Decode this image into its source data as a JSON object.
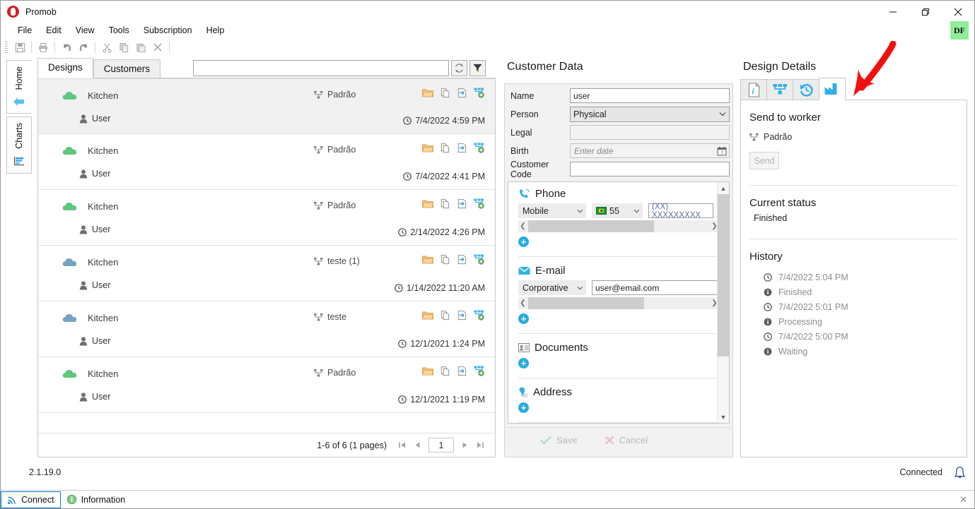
{
  "window": {
    "title": "Promob",
    "minimize": "—",
    "maximize": "❐",
    "close": "✕",
    "avatar_initials": "DF",
    "avatar_color": "#90ee9b"
  },
  "menubar": {
    "items": [
      "File",
      "Edit",
      "View",
      "Tools",
      "Subscription",
      "Help"
    ]
  },
  "toolbar": {
    "icons": [
      "save-icon",
      "print-icon",
      "undo-icon",
      "redo-icon",
      "cut-icon",
      "copy-icon",
      "paste-icon",
      "delete-icon"
    ]
  },
  "sidebar": {
    "items": [
      {
        "label": "Home",
        "icon": "home-icon",
        "active": false
      },
      {
        "label": "Charts",
        "icon": "chart-icon",
        "active": true
      }
    ]
  },
  "designs_panel": {
    "tabs": [
      {
        "label": "Designs",
        "active": true
      },
      {
        "label": "Customers",
        "active": false
      }
    ],
    "search": {
      "value": "",
      "placeholder": ""
    },
    "refresh_icon": "refresh-icon",
    "filter_icon": "filter-icon",
    "rows": [
      {
        "name": "Kitchen",
        "cloud_color": "#5ec77e",
        "category": "Padrão",
        "user": "User",
        "date": "7/4/2022 4:59 PM",
        "selected": true
      },
      {
        "name": "Kitchen",
        "cloud_color": "#5ec77e",
        "category": "Padrão",
        "user": "User",
        "date": "7/4/2022 4:41 PM",
        "selected": false
      },
      {
        "name": "Kitchen",
        "cloud_color": "#5ec77e",
        "category": "Padrão",
        "user": "User",
        "date": "2/14/2022 4:26 PM",
        "selected": false
      },
      {
        "name": "Kitchen",
        "cloud_color": "#76a3c2",
        "category": "teste (1)",
        "user": "User",
        "date": "1/14/2022 11:20 AM",
        "selected": false
      },
      {
        "name": "Kitchen",
        "cloud_color": "#76a3c2",
        "category": "teste",
        "user": "User",
        "date": "12/1/2021 1:24 PM",
        "selected": false
      },
      {
        "name": "Kitchen",
        "cloud_color": "#5ec77e",
        "category": "Padrão",
        "user": "User",
        "date": "12/1/2021 1:19 PM",
        "selected": false
      }
    ],
    "row_action_icons": [
      "open-folder-icon",
      "copy-icon",
      "export-icon",
      "share-add-icon"
    ],
    "pager": {
      "summary": "1-6 of 6 (1 pages)",
      "first": "◀┃",
      "prev": "◀",
      "page": "1",
      "next": "▶",
      "last": "┃▶"
    }
  },
  "customer_panel": {
    "title": "Customer Data",
    "fields": [
      {
        "label": "Name",
        "value": "user",
        "type": "text"
      },
      {
        "label": "Person",
        "value": "Physical",
        "type": "select"
      },
      {
        "label": "Legal",
        "value": "",
        "type": "readonly"
      },
      {
        "label": "Birth",
        "value": "",
        "placeholder": "Enter date",
        "type": "date"
      },
      {
        "label": "Customer Code",
        "value": "",
        "type": "text"
      }
    ],
    "sections": {
      "phone": {
        "title": "Phone",
        "icon": "phone-icon",
        "type": "Mobile",
        "country_code": "55",
        "country_flag": "brazil-flag-icon",
        "number_placeholder": "(XX) XXXXXXXXX",
        "add_label": "+"
      },
      "email": {
        "title": "E-mail",
        "icon": "mail-icon",
        "type": "Corporative",
        "value": "user@email.com",
        "add_label": "+"
      },
      "documents": {
        "title": "Documents",
        "icon": "documents-icon",
        "add_label": "+"
      },
      "address": {
        "title": "Address",
        "icon": "pin-icon",
        "add_label": "+"
      }
    },
    "save_label": "Save",
    "cancel_label": "Cancel"
  },
  "details_panel": {
    "title": "Design Details",
    "tabs": [
      {
        "icon": "info-icon",
        "active": false
      },
      {
        "icon": "hierarchy-icon",
        "active": false
      },
      {
        "icon": "history-icon",
        "active": false
      },
      {
        "icon": "factory-icon",
        "active": true
      }
    ],
    "send_heading": "Send to worker",
    "category": "Padrão",
    "send_button": "Send",
    "current_status_heading": "Current status",
    "current_status_value": "Finished",
    "history_heading": "History",
    "history": [
      {
        "time": "7/4/2022 5:04 PM",
        "status": "Finished"
      },
      {
        "time": "7/4/2022 5:01 PM",
        "status": "Processing"
      },
      {
        "time": "7/4/2022 5:00 PM",
        "status": "Waiting"
      }
    ]
  },
  "footer": {
    "version": "2.1.19.0",
    "connection": "Connected",
    "bell_icon": "bell-icon",
    "connect_label": "Connect",
    "information_label": "Information",
    "close_label": "✕"
  },
  "annotation": {
    "arrow_color": "#f40f0f",
    "points_to": "factory-tab"
  }
}
